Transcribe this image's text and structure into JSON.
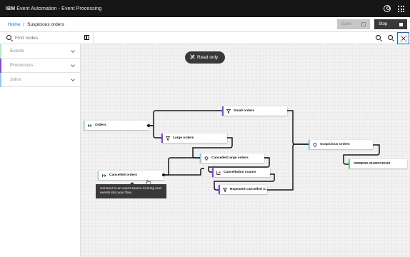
{
  "app": {
    "brand_ibm": "IBM",
    "brand_name": "Event Automation - Event Processing"
  },
  "breadcrumb": {
    "home": "Home",
    "separator": "/",
    "current": "Suspicious orders"
  },
  "actions": {
    "save_label": "Save",
    "stop_label": "Stop"
  },
  "search": {
    "placeholder": "Find nodes",
    "value": ""
  },
  "palette": [
    {
      "label": "Events",
      "color": "#a7f0ba"
    },
    {
      "label": "Processors",
      "color": "#8a3ffc"
    },
    {
      "label": "Joins",
      "color": "#82cfff"
    }
  ],
  "canvas": {
    "status_pill": "Read only",
    "nodes": {
      "orders": "Orders",
      "small_orders": "Small orders",
      "large_orders": "Large orders",
      "cancelled_large_orders": "Cancelled large orders",
      "cancelled_orders": "Cancelled orders",
      "cancellation_counts": "Cancellation counts",
      "repeated_cancelled": "Repeated cancelled o...",
      "suspicious_orders": "Suspicious orders",
      "orders_suspicious": "ORDERS.SUSPICIOUS"
    },
    "tooltip": "Connect to an event source to bring new events into your flow."
  },
  "colors": {
    "topbar": "#161616",
    "accent": "#0f62fe",
    "event": "#a7f0ba",
    "processor": "#8a3ffc",
    "join": "#82cfff",
    "destination": "#6fdc8c"
  }
}
